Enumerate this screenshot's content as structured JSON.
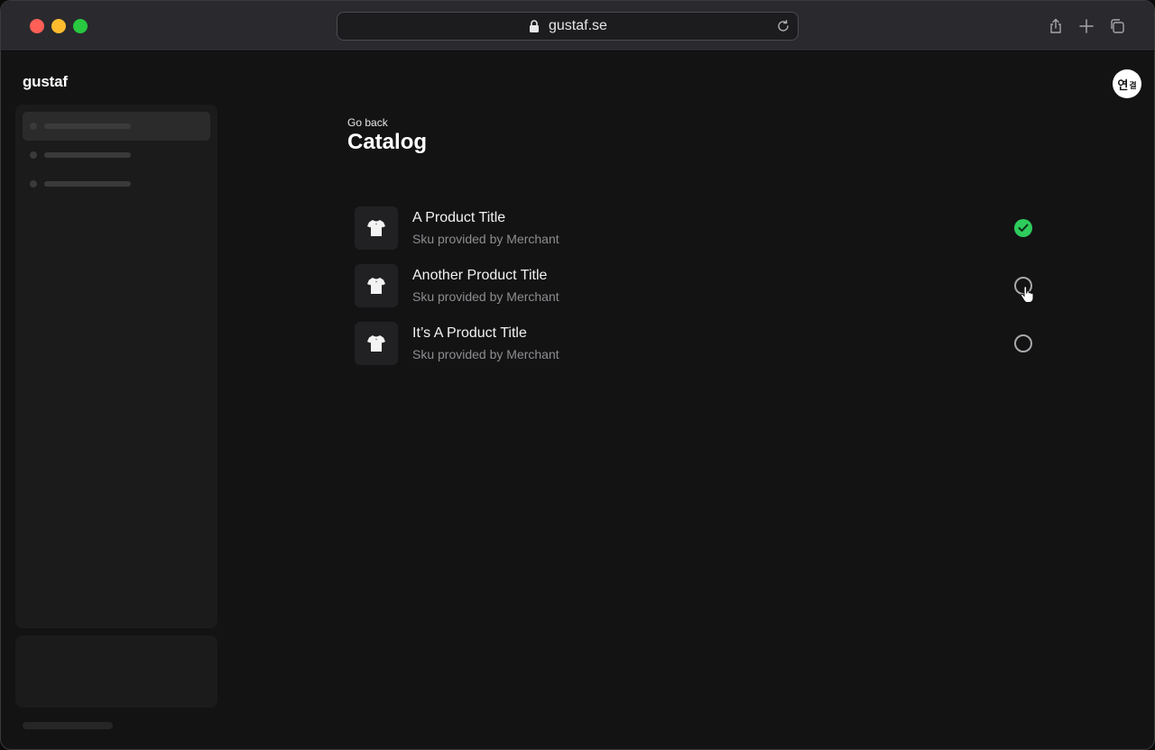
{
  "browser": {
    "url": "gustaf.se"
  },
  "app": {
    "brand": "gustaf",
    "avatar_text_main": "연",
    "avatar_text_small": "결"
  },
  "page": {
    "back_label": "Go back",
    "title": "Catalog"
  },
  "products": [
    {
      "title": "A Product Title",
      "sku": "Sku provided by Merchant",
      "selected": true
    },
    {
      "title": "Another Product Title",
      "sku": "Sku provided by Merchant",
      "selected": false
    },
    {
      "title": "It’s A Product Title",
      "sku": "Sku provided by Merchant",
      "selected": false
    }
  ],
  "colors": {
    "accent_green": "#2ecc5c",
    "background": "#131314",
    "sidebar": "#1b1b1c"
  },
  "icons": {
    "lock": "lock-icon",
    "reload": "reload-icon",
    "share": "share-icon",
    "new_tab": "plus-icon",
    "tabs": "tabs-icon",
    "product": "tshirt-icon",
    "check": "check-icon"
  }
}
